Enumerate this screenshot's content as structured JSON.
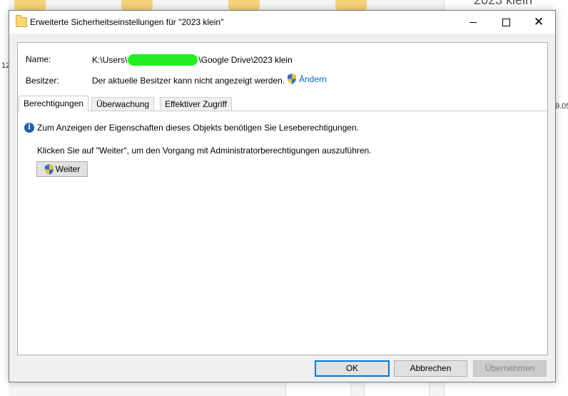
{
  "background": {
    "left_number": "12",
    "right_title": "2023 klein",
    "right_number": "9.05"
  },
  "window": {
    "title": "Erweiterte Sicherheitseinstellungen für \"2023 klein\"",
    "icon": "folder-icon",
    "controls": {
      "minimize": "minimize-icon",
      "maximize": "maximize-icon",
      "close": "close-icon",
      "close_glyph": "✕"
    }
  },
  "details": {
    "name_label": "Name:",
    "name_prefix": "K:\\Users\\",
    "name_suffix": "\\Google Drive\\2023 klein",
    "owner_label": "Besitzer:",
    "owner_value": "Der aktuelle Besitzer kann nicht angezeigt werden.",
    "change_link": "Ändern"
  },
  "tabs": [
    {
      "label": "Berechtigungen",
      "active": true
    },
    {
      "label": "Überwachung",
      "active": false
    },
    {
      "label": "Effektiver Zugriff",
      "active": false
    }
  ],
  "permissions": {
    "info_text": "Zum Anzeigen der Eigenschaften dieses Objekts benötigen Sie Leseberechtigungen.",
    "instruction": "Klicken Sie auf \"Weiter\", um den Vorgang mit Administratorberechtigungen auszuführen.",
    "continue_label": "Weiter"
  },
  "footer": {
    "ok": "OK",
    "cancel": "Abbrechen",
    "apply": "Übernehmen"
  },
  "colors": {
    "accent": "#0078d7",
    "link": "#0066cc",
    "redaction": "#22ee22"
  }
}
